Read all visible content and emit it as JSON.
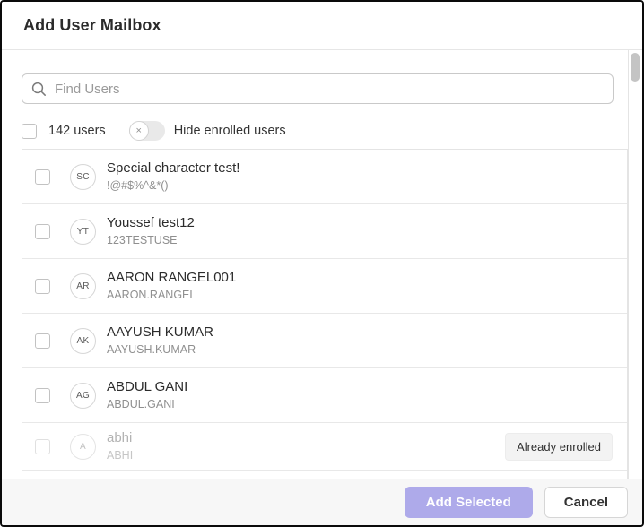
{
  "dialog": {
    "title": "Add User Mailbox"
  },
  "search": {
    "placeholder": "Find Users",
    "value": ""
  },
  "filters": {
    "user_count_label": "142 users",
    "toggle_label": "Hide enrolled users",
    "toggle_state": "off",
    "toggle_off_glyph": "×"
  },
  "users": [
    {
      "initials": "SC",
      "name": "Special character test!",
      "username": "!@#$%^&*()",
      "enrolled": false,
      "checked": false
    },
    {
      "initials": "YT",
      "name": "Youssef test12",
      "username": "123TESTUSE",
      "enrolled": false,
      "checked": false
    },
    {
      "initials": "AR",
      "name": "AARON RANGEL001",
      "username": "AARON.RANGEL",
      "enrolled": false,
      "checked": false
    },
    {
      "initials": "AK",
      "name": "AAYUSH KUMAR",
      "username": "AAYUSH.KUMAR",
      "enrolled": false,
      "checked": false
    },
    {
      "initials": "AG",
      "name": "ABDUL GANI",
      "username": "ABDUL.GANI",
      "enrolled": false,
      "checked": false
    },
    {
      "initials": "A",
      "name": "abhi",
      "username": "ABHI",
      "enrolled": true,
      "checked": false,
      "badge": "Already enrolled"
    }
  ],
  "footer": {
    "add_selected_label": "Add Selected",
    "cancel_label": "Cancel"
  },
  "colors": {
    "accent": "#aeaaea",
    "badge_bg": "#f3f3f3",
    "footer_bg": "#f7f7f7",
    "border": "#e4e4e4"
  }
}
